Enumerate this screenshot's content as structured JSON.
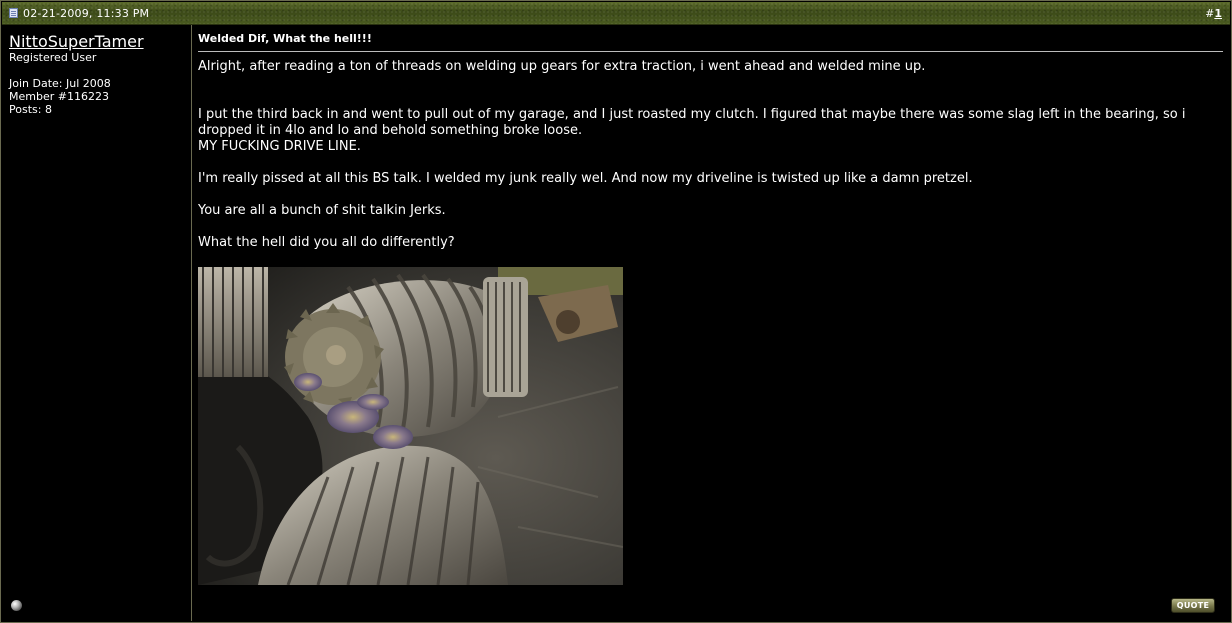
{
  "post": {
    "date": "02-21-2009, 11:33 PM",
    "number_prefix": "#",
    "number": "1",
    "title": "Welded Dif, What the hell!!!",
    "body": {
      "p1": "Alright, after reading a ton of threads on welding up gears for extra traction, i went ahead and welded mine up.",
      "p2_line1": "I put the third back in and went to pull out of my garage, and I just roasted my clutch. I figured that maybe there was some slag left in the bearing, so i dropped it in 4lo and lo and behold something broke loose.",
      "p2_line2": "MY FUCKING DRIVE LINE.",
      "p3": "I'm really pissed at all this BS talk. I welded my junk really wel. And now my driveline is twisted up like a damn pretzel.",
      "p4": "You are all a bunch of shit talkin Jerks.",
      "p5": "What the hell did you all do differently?"
    },
    "quote_button": "QUOTE"
  },
  "user": {
    "name": "NittoSuperTamer",
    "title": "Registered User",
    "join_date": "Join Date: Jul 2008",
    "member": "Member #116223",
    "posts": "Posts: 8"
  },
  "icons": {
    "post_icon": "post-icon",
    "status_icon": "offline-status-icon"
  },
  "colors": {
    "header_bar": "#4a5a20",
    "background": "#000000",
    "border": "#6a6a50",
    "text": "#ffffff"
  }
}
